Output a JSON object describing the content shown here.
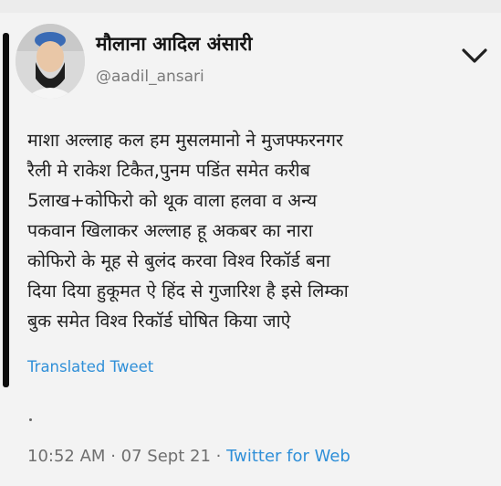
{
  "header": {
    "display_name": "मौलाना आदिल अंसारी",
    "handle": "@aadil_ansari"
  },
  "tweet": {
    "lines": [
      "माशा अल्लाह कल हम मुसलमानो ने मुजफ्फरनगर",
      "रैली मे राकेश टिकैत,पुनम पडिंत समेत करीब",
      "5लाख+कोफिरो को थूक वाला हलवा व अन्य",
      "पकवान खिलाकर अल्लाह हू अकबर का नारा",
      "कोफिरो के मूह से बुलंद करवा विश्व रिकॉर्ड बना",
      "दिया दिया हुकूमत ऐ हिंद से गुजारिश है इसे लिम्का",
      "बुक समेत विश्व रिकॉर्ड घोषित किया जाऐ"
    ],
    "translated_label": "Translated Tweet"
  },
  "meta": {
    "time": "10:52 AM",
    "date": "07 Sept 21",
    "source": "Twitter for Web",
    "separator": "·"
  },
  "icons": {
    "menu": "chevron-down-icon",
    "avatar": "avatar"
  },
  "colors": {
    "accent": "#2f8fd8",
    "text": "#1f1f1f",
    "muted": "#7a7a7a"
  }
}
